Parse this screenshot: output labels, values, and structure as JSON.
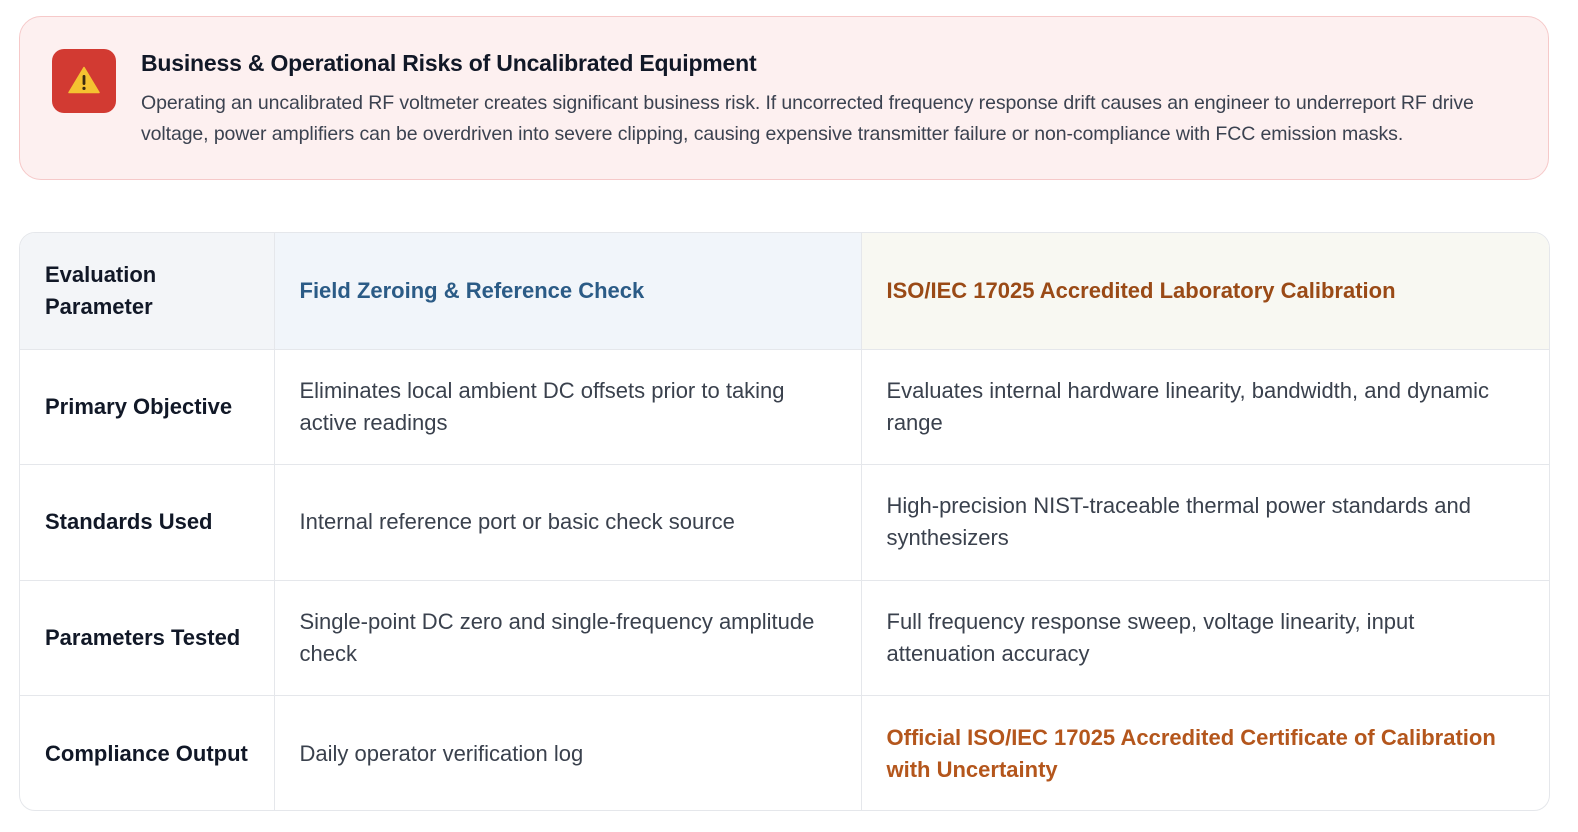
{
  "alert": {
    "icon": "warning-triangle-icon",
    "accent_color": "#d23a32",
    "title": "Business & Operational Risks of Uncalibrated Equipment",
    "body": "Operating an uncalibrated RF voltmeter creates significant business risk. If uncorrected frequency response drift causes an engineer to underreport RF drive voltage, power amplifiers can be overdriven into severe clipping, causing expensive transmitter failure or non-compliance with FCC emission masks."
  },
  "table": {
    "headers": [
      "Evaluation Parameter",
      "Field Zeroing & Reference Check",
      "ISO/IEC 17025 Accredited Laboratory Calibration"
    ],
    "header_colors": {
      "field": "#2b5b86",
      "iso": "#9a4a16"
    },
    "rows": [
      {
        "parameter": "Primary Objective",
        "field": "Eliminates local ambient DC offsets prior to taking active readings",
        "iso": "Evaluates internal hardware linearity, bandwidth, and dynamic range"
      },
      {
        "parameter": "Standards Used",
        "field": "Internal reference port or basic check source",
        "iso": "High-precision NIST-traceable thermal power standards and synthesizers"
      },
      {
        "parameter": "Parameters Tested",
        "field": "Single-point DC zero and single-frequency amplitude check",
        "iso": "Full frequency response sweep, voltage linearity, input attenuation accuracy"
      },
      {
        "parameter": "Compliance Output",
        "field": "Daily operator verification log",
        "iso": "Official ISO/IEC 17025 Accredited Certificate of Calibration with Uncertainty"
      }
    ],
    "highlight_color": "#b4561c"
  }
}
